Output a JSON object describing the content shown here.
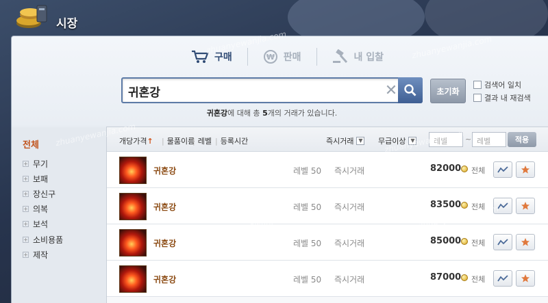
{
  "window": {
    "title": "시장"
  },
  "tabs": [
    {
      "label": "구매",
      "icon": "cart-icon",
      "active": true
    },
    {
      "label": "판매",
      "icon": "sell-icon",
      "active": false
    },
    {
      "label": "내 입찰",
      "icon": "gavel-icon",
      "active": false
    }
  ],
  "search": {
    "value": "귀혼강",
    "reset_label": "초기화",
    "option_exact": "검색어 일치",
    "option_within": "결과 내 재검색"
  },
  "result": {
    "keyword": "귀혼강",
    "mid": "에 대해 총 ",
    "count": "5",
    "tail": "개의 거래가 있습니다."
  },
  "sidebar": {
    "all_label": "전체",
    "items": [
      "무기",
      "보패",
      "장신구",
      "의복",
      "보석",
      "소비용품",
      "제작"
    ]
  },
  "list_header": {
    "sort_price": "개당가격",
    "sort_arrow": "↑",
    "sort_name": "물품이름",
    "sort_level": "레벨",
    "sort_time": "등록시간",
    "trade_type": "즉시거래",
    "grade": "무급이상",
    "level_from_placeholder": "레벨",
    "tilde": "~",
    "level_to_placeholder": "레벨",
    "apply_label": "적용"
  },
  "rows": [
    {
      "name": "귀혼강",
      "level": "레벨 50",
      "type": "즉시거래",
      "price": "82000",
      "scope": "전체"
    },
    {
      "name": "귀혼강",
      "level": "레벨 50",
      "type": "즉시거래",
      "price": "83500",
      "scope": "전체"
    },
    {
      "name": "귀혼강",
      "level": "레벨 50",
      "type": "즉시거래",
      "price": "85000",
      "scope": "전체"
    },
    {
      "name": "귀혼강",
      "level": "레벨 50",
      "type": "즉시거래",
      "price": "87000",
      "scope": "전체"
    }
  ],
  "watermark": "zhuanyewanjia.com",
  "colors": {
    "accent": "#2f4a74",
    "category_active": "#c0521b",
    "item_name": "#8b4a12"
  }
}
